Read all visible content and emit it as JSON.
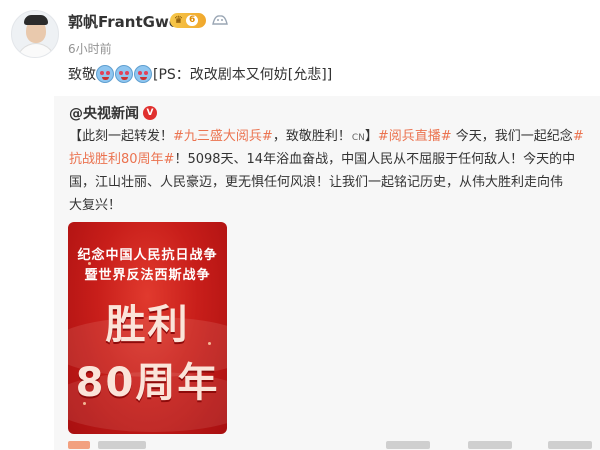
{
  "post": {
    "author": "郭帆FrantGwo",
    "vip_level": "6",
    "timestamp": "6小时前",
    "text_prefix": "致敬",
    "text_suffix": "[PS：改改剧本又何妨[允悲]]",
    "emoji_icons": [
      "crying-face-icon",
      "crying-face-icon",
      "crying-face-icon"
    ]
  },
  "repost": {
    "author": "@央视新闻",
    "body_lines": [
      [
        {
          "text": "【此刻一起转发！",
          "tag": false
        },
        {
          "text": "#九三盛大阅兵#",
          "tag": true
        },
        {
          "text": "，致敬胜利！",
          "tag": false
        },
        {
          "text": "CN",
          "tag": false,
          "small": true
        },
        {
          "text": "】",
          "tag": false
        },
        {
          "text": "#阅兵直播#",
          "tag": true
        },
        {
          "text": " 今天，我们一起纪念",
          "tag": false
        },
        {
          "text": "#",
          "tag": true
        }
      ],
      [
        {
          "text": "抗战胜利80周年#",
          "tag": true
        },
        {
          "text": "！5098天、14年浴血奋战，中国人民从不屈服于任何敌人！今天的中",
          "tag": false
        }
      ],
      [
        {
          "text": "国，江山壮丽、人民豪迈，更无惧任何风浪！让我们一起铭记历史，从伟大胜利走向伟",
          "tag": false
        }
      ],
      [
        {
          "text": "大复兴！",
          "tag": false
        }
      ]
    ],
    "poster": {
      "line1": "纪念中国人民抗日战争",
      "line2": "暨世界反法西斯战争",
      "big1": "胜利",
      "big2": "80周年"
    }
  },
  "colors": {
    "tag": "#eb7350",
    "poster_red": "#c81e1a",
    "repost_bg": "#f7f7f7"
  }
}
